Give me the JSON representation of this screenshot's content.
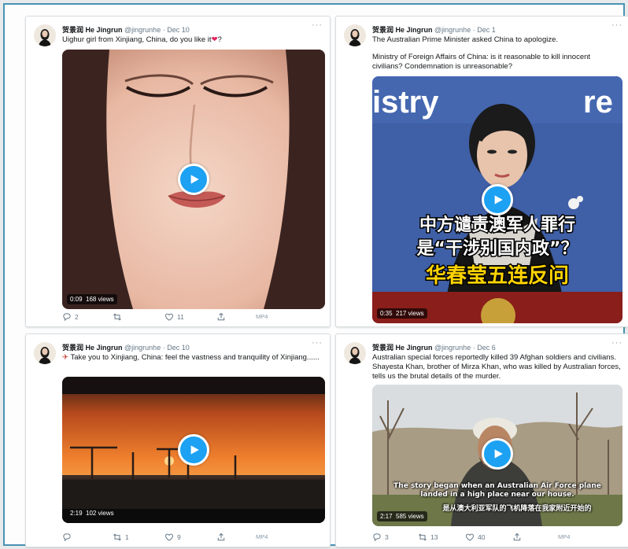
{
  "tweets": [
    {
      "display_name": "贺景润 He Jingrun",
      "handle": "@jingrunhe",
      "date": "Dec 10",
      "text": [
        "Uighur girl from Xinjiang, China, do you like it",
        "?"
      ],
      "video": {
        "duration": "0:09",
        "views": "168 views"
      },
      "actions": {
        "replies": "2",
        "retweets": "",
        "likes": "11",
        "format": "MP4"
      }
    },
    {
      "display_name": "贺景润 He Jingrun",
      "handle": "@jingrunhe",
      "date": "Dec 1",
      "text": [
        "The Australian Prime Minister asked China to apologize.",
        "Ministry of Foreign Affairs of China: is it reasonable to kill innocent civilians? Condemnation is unreasonable?"
      ],
      "video": {
        "duration": "0:35",
        "views": "217 views",
        "bg_text": "istry",
        "bg_text_right": "re",
        "caption_line1": "中方谴责澳军人罪行",
        "caption_line2": "是“干涉别国内政”？",
        "caption_line3": "华春莹五连反问"
      },
      "actions": {
        "replies": "",
        "retweets": "",
        "likes": "",
        "format": ""
      }
    },
    {
      "display_name": "贺景润 He Jingrun",
      "handle": "@jingrunhe",
      "date": "Dec 10",
      "text": [
        "Take you to Xinjiang, China: feel the vastness and tranquility of Xinjiang......"
      ],
      "video": {
        "duration": "2:19",
        "views": "102 views"
      },
      "actions": {
        "replies": "",
        "retweets": "1",
        "likes": "9",
        "format": "MP4"
      }
    },
    {
      "display_name": "贺景润 He Jingrun",
      "handle": "@jingrunhe",
      "date": "Dec 6",
      "text": [
        "Australian special forces reportedly killed 39 Afghan soldiers and civilians. Shayesta Khan, brother of Mirza Khan, who was killed by Australian forces, tells us the brutal details of the murder."
      ],
      "video": {
        "duration": "2:17",
        "views": "585 views",
        "subtitle_en": "The story began when an Australian Air Force plane landed in a high place near our house.",
        "subtitle_zh": "是从澳大利亚军队的飞机降落在我家附近开始的"
      },
      "actions": {
        "replies": "3",
        "retweets": "13",
        "likes": "40",
        "format": "MP4"
      }
    }
  ],
  "colors": {
    "accent": "#1da1f2",
    "frame": "#4a93b3",
    "heart": "#e0245e"
  },
  "icons": [
    "reply-icon",
    "retweet-icon",
    "like-icon",
    "share-icon",
    "play-icon",
    "more-icon",
    "heart-emoji",
    "airplane-emoji"
  ]
}
